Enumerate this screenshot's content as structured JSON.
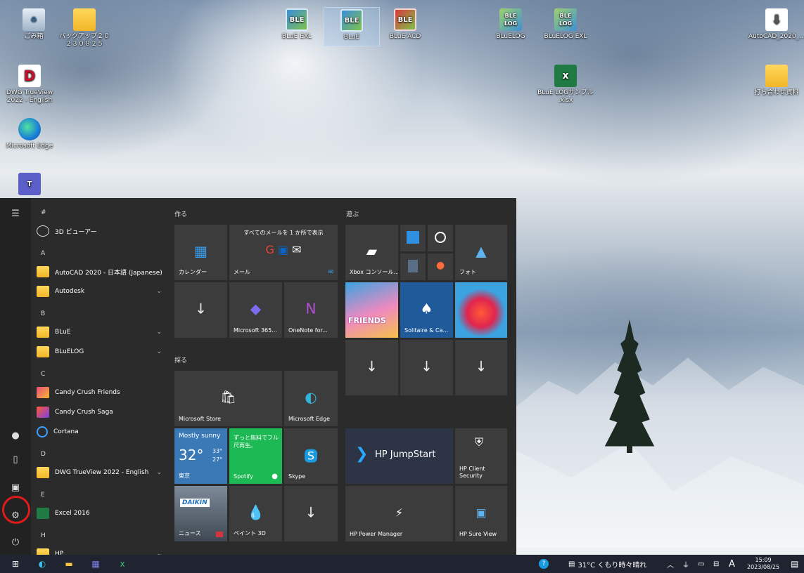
{
  "desktop": {
    "icons": [
      {
        "label": "ごみ箱"
      },
      {
        "label": "バックアップ２０２３０８２５"
      },
      {
        "label": "BLuE EXL",
        "mark": "BLE"
      },
      {
        "label": "BLuE",
        "mark": "BLE"
      },
      {
        "label": "BLuE ACD",
        "mark": "BLE"
      },
      {
        "label": "BLuELOG",
        "mark": "BLE LOG"
      },
      {
        "label": "BLuELOG EXL",
        "mark": "BLE LOG"
      },
      {
        "label": "AutoCAD_2020_..."
      },
      {
        "label": "DWG TrueView 2022 - English",
        "mark": "D"
      },
      {
        "label": "BLuE LOGサンプル .xlsx",
        "mark": "x"
      },
      {
        "label": "打ち合わせ資料"
      },
      {
        "label": "Microsoft Edge"
      }
    ]
  },
  "start_menu": {
    "apps": {
      "hash": "#",
      "app_3d": "3D ビューアー",
      "letter_a": "A",
      "autocad": "AutoCAD 2020 - 日本語 (Japanese)",
      "autodesk": "Autodesk",
      "letter_b": "B",
      "blue": "BLuE",
      "bluelog": "BLuELOG",
      "letter_c": "C",
      "candy_friends": "Candy Crush Friends",
      "candy_saga": "Candy Crush Saga",
      "cortana": "Cortana",
      "letter_d": "D",
      "dwg": "DWG TrueView 2022 - English",
      "letter_e": "E",
      "excel": "Excel 2016",
      "letter_h": "H",
      "hp": "HP"
    },
    "groups": {
      "create": "作る",
      "explore": "探る",
      "play": "遊ぶ"
    },
    "tiles": {
      "calendar": "カレンダー",
      "mail": "メール",
      "mail_banner": "すべてのメールを 1 か所で表示",
      "m365": "Microsoft 365...",
      "onenote": "OneNote for...",
      "store": "Microsoft Store",
      "edge": "Microsoft Edge",
      "weather_cond": "Mostly sunny",
      "weather_temp": "32°",
      "weather_hi": "33°",
      "weather_lo": "27°",
      "weather_city": "東京",
      "spotify_promo": "ずっと無料でフル尺再生。",
      "spotify": "Spotify",
      "skype": "Skype",
      "news": "ニュース",
      "paint3d": "ペイント 3D",
      "xbox": "Xbox コンソール...",
      "photos": "フォト",
      "solitaire": "Solitaire & Ca...",
      "friends_text": "FRIENDS",
      "hp_jumpstart": "HP JumpStart",
      "hp_client_security": "HP Client Security",
      "hp_power": "HP Power Manager",
      "hp_sure": "HP Sure View",
      "news_brand": "DAIKIN"
    }
  },
  "taskbar": {
    "weather": "31°C くもり時々晴れ",
    "ime": "A",
    "time": "15:09",
    "date": "2023/08/25"
  },
  "colors": {
    "highlight": "#e01b1b",
    "spotify": "#1db954",
    "weather_tile": "#3b79b6",
    "hp_blue": "#0a6cc4"
  }
}
